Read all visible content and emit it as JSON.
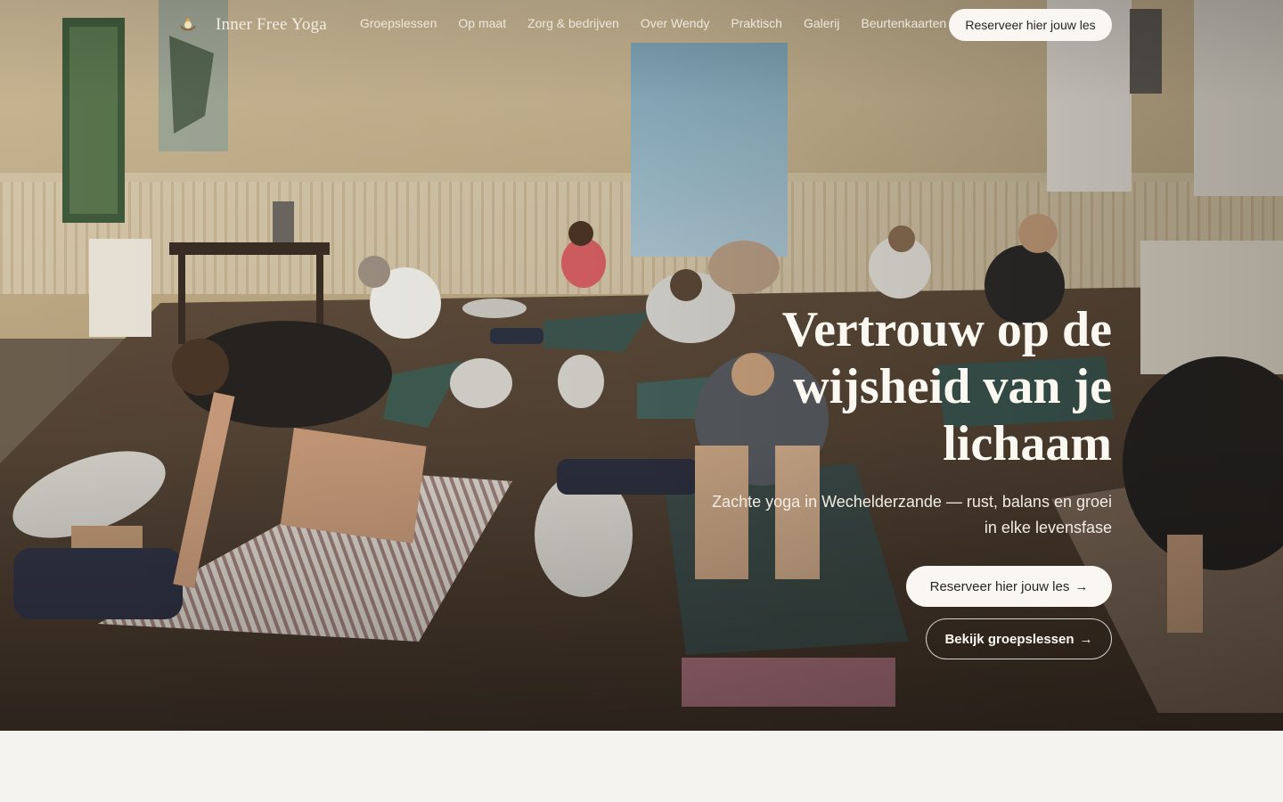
{
  "brand": {
    "name": "Inner Free Yoga",
    "logo_icon": "lotus-heart-icon"
  },
  "nav": {
    "links": [
      "Groepslessen",
      "Op maat",
      "Zorg & bedrijven",
      "Over Wendy",
      "Praktisch",
      "Galerij",
      "Beurtenkaarten"
    ],
    "cta_label": "Reserveer hier jouw les"
  },
  "hero": {
    "title_lines": [
      "Vertrouw op de",
      "wijsheid van je",
      "lichaam"
    ],
    "subtitle_lines": [
      "Zachte yoga in Wechelderzande — rust, balans en groei",
      "in elke levensfase"
    ],
    "primary_button": "Reserveer hier jouw les",
    "secondary_button": "Bekijk groepslessen",
    "arrow": "→"
  },
  "colors": {
    "accent_light": "#faf7f2",
    "text_dark": "#2a2420",
    "page_bg": "#f4f3f0"
  }
}
